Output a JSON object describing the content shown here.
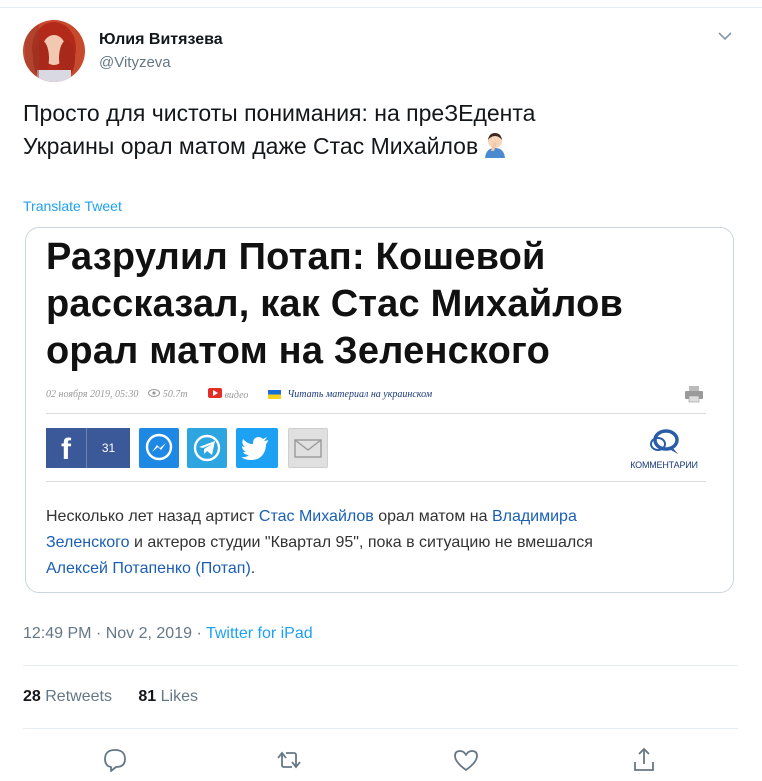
{
  "author": {
    "name": "Юлия Витязева",
    "handle": "@Vityzeva"
  },
  "tweet": {
    "text_lines": [
      "Просто для чистоты понимания: на преЗЕдента",
      "Украины орал матом даже Стас Михайлов"
    ],
    "emoji": "face-palm-icon",
    "translate_label": "Translate Tweet"
  },
  "article": {
    "headline_lines": [
      "Разрулил Потап: Кошевой",
      "рассказал, как Стас Михайлов",
      "орал матом на Зеленского"
    ],
    "meta": {
      "date": "02 ноября 2019, 05:30",
      "views": "50.7т",
      "video_label": "видео",
      "read_ukrainian": "Читать материал на украинском"
    },
    "share": {
      "facebook_count": "31"
    },
    "comments_label": "КОММЕНТАРИИ",
    "body": {
      "l1a": "Несколько лет назад артист ",
      "l1b": "Стас Михайлов",
      "l1c": " орал матом на ",
      "l1d": "Владимира",
      "l2a": "Зеленского",
      "l2b": " и актеров студии \"Квартал 95\", пока в ситуацию не вмешался",
      "l3a": "Алексей Потапенко (Потап)",
      "l3b": "."
    }
  },
  "footer": {
    "time": "12:49 PM",
    "date": "Nov 2, 2019",
    "source": "Twitter for iPad",
    "retweets_count": "28",
    "retweets_label": "Retweets",
    "likes_count": "81",
    "likes_label": "Likes"
  },
  "colors": {
    "accent": "#1da1f2",
    "text": "#14171a",
    "muted": "#657786",
    "link": "#1a5fb4",
    "facebook": "#3b5998"
  }
}
